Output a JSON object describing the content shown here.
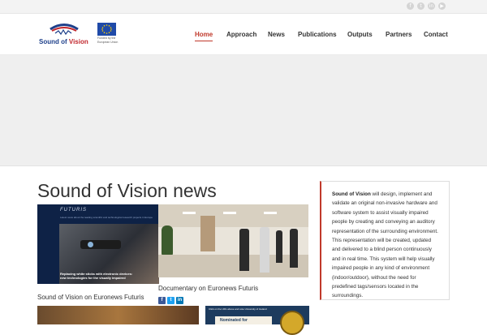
{
  "social_icons": [
    {
      "name": "facebook-icon",
      "glyph": "f"
    },
    {
      "name": "twitter-icon",
      "glyph": "t"
    },
    {
      "name": "linkedin-icon",
      "glyph": "in"
    },
    {
      "name": "youtube-icon",
      "glyph": "▶"
    }
  ],
  "logo": {
    "sound_of": "Sound of",
    "vision": "Vision"
  },
  "eu": {
    "caption_line1": "Funded by the",
    "caption_line2": "European Union"
  },
  "nav": {
    "items": [
      {
        "label": "Home",
        "active": true
      },
      {
        "label": "Approach"
      },
      {
        "label": "News"
      },
      {
        "label": "Publications"
      },
      {
        "label": "Outputs"
      },
      {
        "label": "Partners"
      },
      {
        "label": "Contact"
      }
    ]
  },
  "main": {
    "title": "Sound of Vision news",
    "thumb1": {
      "brand": "FUTURIS",
      "sub": "Latest news about the leading scientific and technological research projects in Europe",
      "caption_line1": "Replacing white sticks with electronic devices:",
      "caption_line2": "new technologies for the visually impaired"
    },
    "caption_left": "Sound of Vision on Euronews Futuris",
    "caption_mid": "Documentary on Euronews Futuris",
    "shares": [
      {
        "name": "facebook-share-icon",
        "glyph": "f",
        "color": "#3b5998"
      },
      {
        "name": "twitter-share-icon",
        "glyph": "t",
        "color": "#1da1f2"
      },
      {
        "name": "linkedin-share-icon",
        "glyph": "in",
        "color": "#0077b5"
      }
    ],
    "thumb4": {
      "top_text": "Click on the URL above and vote University of Iceland",
      "nominated": "Nominated for"
    }
  },
  "sidebar": {
    "bold": "Sound of Vision",
    "text": " will design, implement and validate an original non-invasive hardware and software system to assist visually impaired people by creating and conveying an auditory representation of the surrounding environment. This representation will be created, updated and delivered to a blind person continuously and in real time. This system will help visually impaired people in any kind of environment (indoor/outdoor), without the need for predefined tags/sensors located in the surroundings."
  },
  "colors": {
    "accent": "#c0392b",
    "brand_blue": "#1d3f8a",
    "eu_blue": "#1f4aa8"
  }
}
